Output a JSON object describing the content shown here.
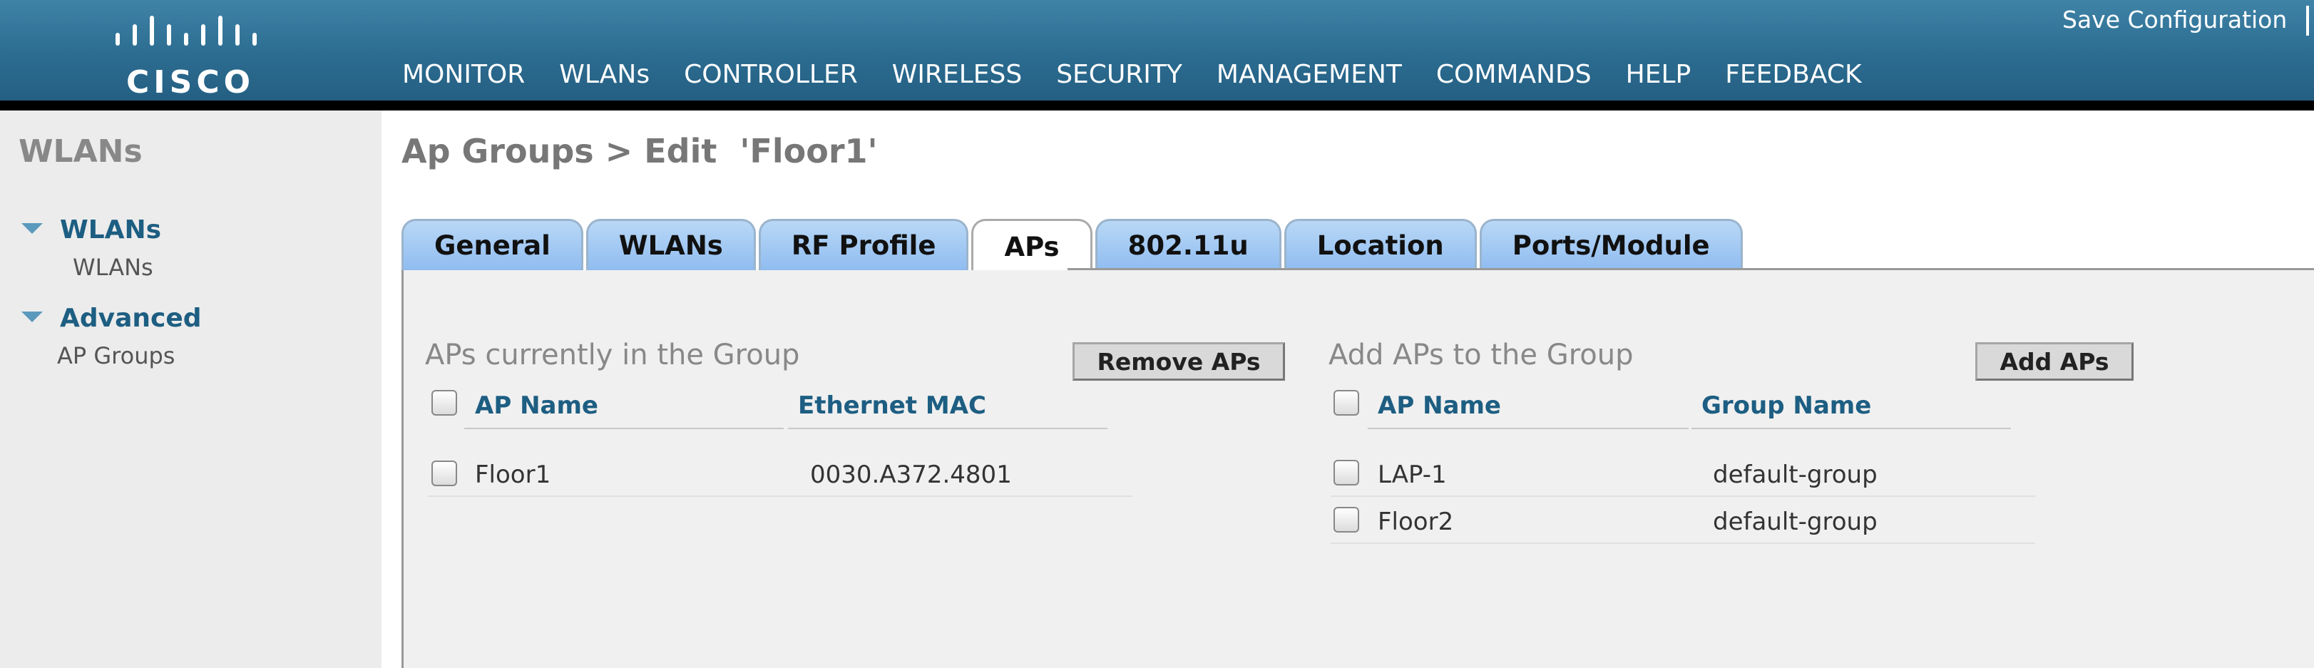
{
  "header": {
    "logo_text": "CISCO",
    "save_label": "Save Configuration",
    "nav": [
      {
        "label": "MONITOR",
        "active": false
      },
      {
        "label": "WLANs",
        "active": true
      },
      {
        "label": "CONTROLLER",
        "active": false
      },
      {
        "label": "WIRELESS",
        "active": false
      },
      {
        "label": "SECURITY",
        "active": false
      },
      {
        "label": "MANAGEMENT",
        "active": false
      },
      {
        "label": "COMMANDS",
        "active": false
      },
      {
        "label": "HELP",
        "active": false
      },
      {
        "label": "FEEDBACK",
        "active": false
      }
    ]
  },
  "sidebar": {
    "title": "WLANs",
    "sections": [
      {
        "label": "WLANs",
        "items": [
          "WLANs"
        ]
      },
      {
        "label": "Advanced",
        "items": [
          "AP Groups"
        ]
      }
    ]
  },
  "page_title": "Ap Groups > Edit  'Floor1'",
  "tabs": [
    {
      "label": "General",
      "active": false
    },
    {
      "label": "WLANs",
      "active": false
    },
    {
      "label": "RF Profile",
      "active": false
    },
    {
      "label": "APs",
      "active": true
    },
    {
      "label": "802.11u",
      "active": false
    },
    {
      "label": "Location",
      "active": false
    },
    {
      "label": "Ports/Module",
      "active": false
    }
  ],
  "current_group": {
    "title": "APs currently in the Group",
    "button": "Remove APs",
    "columns": [
      "AP Name",
      "Ethernet MAC"
    ],
    "rows": [
      {
        "ap_name": "Floor1",
        "mac": "0030.A372.4801"
      }
    ]
  },
  "add_group": {
    "title": "Add APs to the Group",
    "button": "Add APs",
    "columns": [
      "AP Name",
      "Group Name"
    ],
    "rows": [
      {
        "ap_name": "LAP-1",
        "group": "default-group"
      },
      {
        "ap_name": "Floor2",
        "group": "default-group"
      }
    ]
  },
  "colors": {
    "header": "#2c6c91",
    "accent": "#f7941d",
    "tab": "#8fbcf0",
    "link": "#1d5e82"
  }
}
